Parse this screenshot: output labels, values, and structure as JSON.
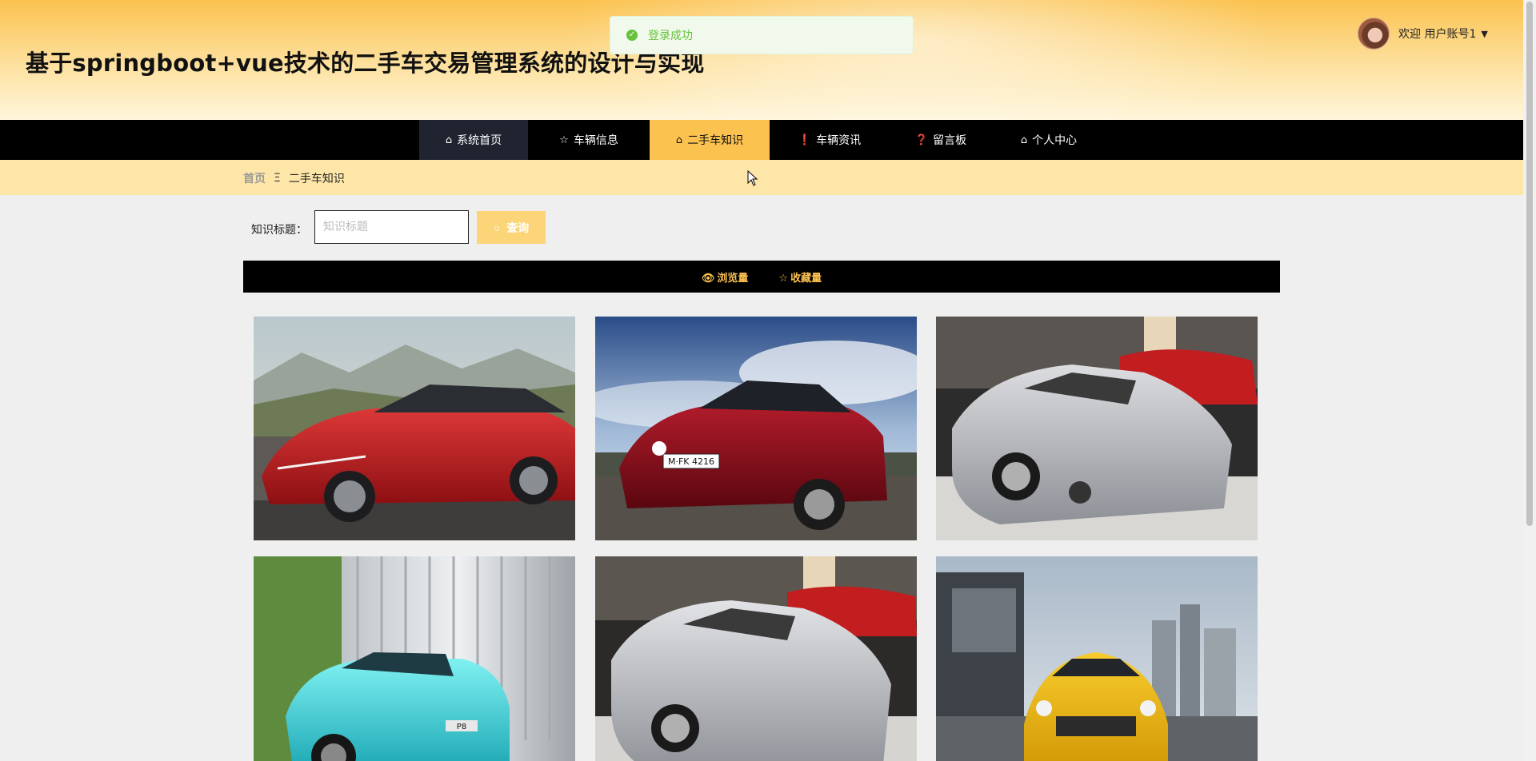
{
  "header": {
    "title": "基于springboot+vue技术的二手车交易管理系统的设计与实现",
    "welcome": "欢迎 用户账号1",
    "caret": "▼"
  },
  "toast": {
    "message": "登录成功"
  },
  "nav": {
    "items": [
      {
        "label": "系统首页",
        "icon": "home-icon"
      },
      {
        "label": "车辆信息",
        "icon": "star-icon"
      },
      {
        "label": "二手车知识",
        "icon": "bag-icon"
      },
      {
        "label": "车辆资讯",
        "icon": "info-icon"
      },
      {
        "label": "留言板",
        "icon": "help-icon"
      },
      {
        "label": "个人中心",
        "icon": "home-icon"
      }
    ],
    "active": "二手车知识"
  },
  "breadcrumb": {
    "home": "首页",
    "separator": "Ξ",
    "current": "二手车知识"
  },
  "search": {
    "label": "知识标题：",
    "placeholder": "知识标题",
    "button": "查询"
  },
  "sort": {
    "views": "浏览量",
    "favorites": "收藏量"
  },
  "cards": [
    {
      "name": "red-sedan-image"
    },
    {
      "name": "red-coupe-image",
      "plate": "M·FK 4216"
    },
    {
      "name": "silver-convertible-image"
    },
    {
      "name": "teal-suv-image",
      "badge": "P8"
    },
    {
      "name": "silver-convertible-image-2"
    },
    {
      "name": "yellow-suv-image"
    }
  ],
  "colors": {
    "accent": "#fbc24f",
    "nav_bg": "#000000",
    "toast_text": "#67c23a"
  }
}
